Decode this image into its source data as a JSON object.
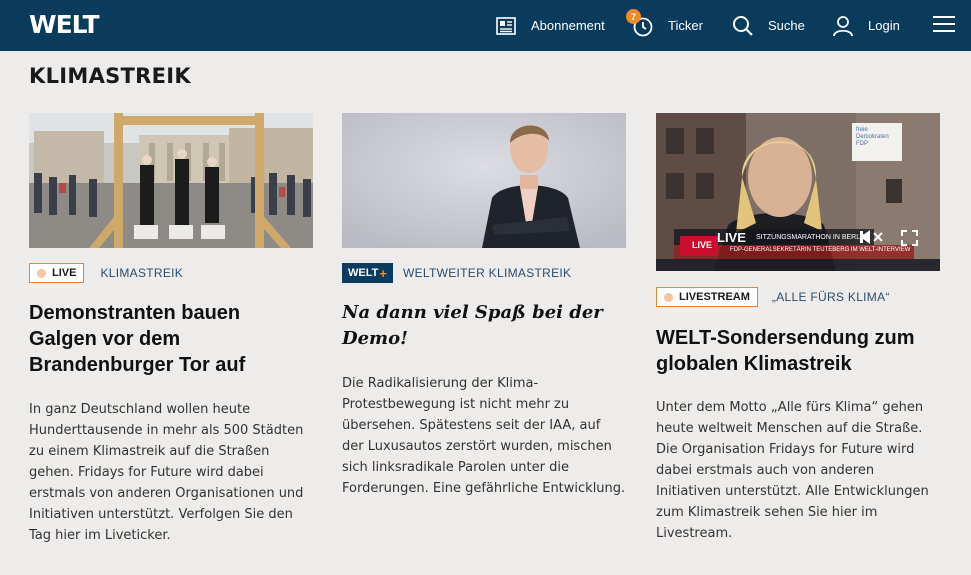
{
  "header": {
    "logo": "WELT",
    "nav": [
      {
        "label": "Abonnement",
        "icon": "newspaper-icon"
      },
      {
        "label": "Ticker",
        "icon": "clock-icon",
        "badge": "7"
      },
      {
        "label": "Suche",
        "icon": "search-icon"
      },
      {
        "label": "Login",
        "icon": "user-icon"
      }
    ],
    "menu_icon": "hamburger-menu-icon"
  },
  "section": {
    "title": "KLIMASTREIK"
  },
  "articles": [
    {
      "tag": "LIVE",
      "kicker": "KLIMASTREIK",
      "headline": "Demonstranten bauen Galgen vor dem Brandenburger Tor auf",
      "teaser": "In ganz Deutschland wollen heute Hunderttausende in mehr als 500 Städten zu einem Klimastreik auf die Straßen gehen. Fridays for Future wird dabei erstmals von anderen Organisationen und Initiativen unterstützt. Verfolgen Sie den Tag hier im Liveticker."
    },
    {
      "tag": "WELT",
      "tag_plus": "+",
      "kicker": "WELTWEITER KLIMASTREIK",
      "headline": "Na dann viel Spaß bei der Demo!",
      "teaser": "Die Radikalisierung der Klima-Protestbewegung ist nicht mehr zu übersehen. Spätestens seit der IAA, auf der Luxusautos zerstört wurden, mischen sich linksradikale Parolen unter die Forderungen. Eine gefährliche Entwicklung."
    },
    {
      "tag": "LIVESTREAM",
      "kicker": "„ALLE FÜRS KLIMA“",
      "headline": "WELT-Sondersendung zum globalen Klimastreik",
      "teaser": "Unter dem Motto „Alle fürs Klima“ gehen heute weltweit Menschen auf die Straße. Die Organisation Fridays for Future wird dabei erstmals auch von anderen Initiativen unterstützt. Alle Entwicklungen zum Klimastreik sehen Sie hier im Livestream.",
      "video": {
        "live_label": "LIVE",
        "live_badge": "LIVE",
        "ticker_text": "SITZUNGSMARATHON IN BERLIN",
        "ticker_sub": "FDP-GENERALSEKRETÄRIN TEUTEBERG IM WELT-INTERVIEW",
        "sign_text": "freie Demokraten FDP"
      }
    }
  ],
  "colors": {
    "header_bg": "#0a3a5c",
    "accent": "#f08a26",
    "page_bg": "#eeecea"
  }
}
